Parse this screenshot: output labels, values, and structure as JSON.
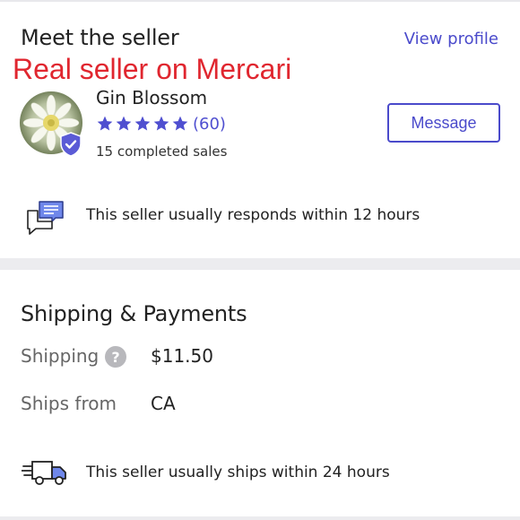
{
  "seller": {
    "section_title": "Meet the seller",
    "view_profile_label": "View profile",
    "overlay_text": "Real seller on Mercari",
    "name": "Gin Blossom",
    "rating_stars": 5,
    "rating_count": "(60)",
    "completed_sales": "15 completed sales",
    "message_label": "Message",
    "response_text": "This seller usually responds within 12 hours",
    "icons": {
      "avatar": "avatar-flower-photo",
      "badge": "verified-shield-icon",
      "star": "star-icon",
      "chat": "chat-bubbles-icon"
    }
  },
  "shipping": {
    "section_title": "Shipping & Payments",
    "shipping_label": "Shipping",
    "shipping_value": "$11.50",
    "ships_from_label": "Ships from",
    "ships_from_value": "CA",
    "ship_time_text": "This seller usually ships within 24 hours",
    "icons": {
      "help": "help-icon",
      "truck": "delivery-truck-icon"
    }
  },
  "colors": {
    "accent": "#4a4acb",
    "overlay_red": "#e0262f",
    "divider": "#ececef",
    "label_gray": "#666666"
  }
}
